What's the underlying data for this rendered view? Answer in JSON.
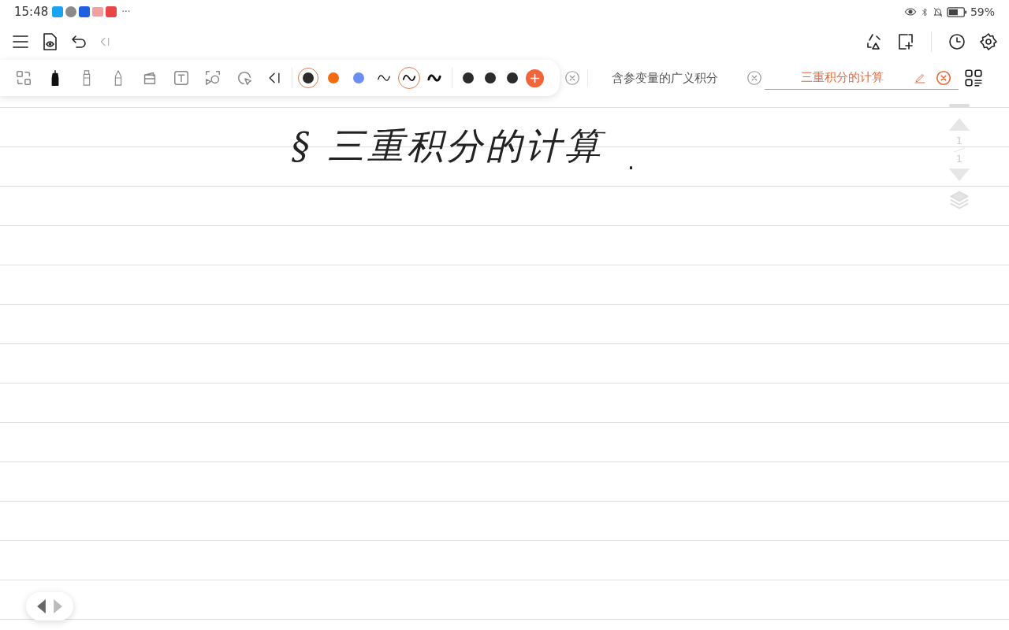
{
  "status_bar": {
    "time": "15:48",
    "more": "···",
    "battery": "59%"
  },
  "tools": [
    {
      "kind": "layout",
      "selected": false
    },
    {
      "kind": "pen",
      "selected": true
    },
    {
      "kind": "marker",
      "selected": false
    },
    {
      "kind": "pencil",
      "selected": false
    },
    {
      "kind": "eraser",
      "selected": false
    },
    {
      "kind": "text",
      "selected": false
    },
    {
      "kind": "shape",
      "selected": false
    },
    {
      "kind": "select",
      "selected": false
    }
  ],
  "colors": [
    {
      "color": "#2b2b2b",
      "selected": true
    },
    {
      "color": "#f26b0f",
      "selected": false
    },
    {
      "color": "#6a8ff0",
      "selected": false
    }
  ],
  "strokes": [
    {
      "kind": "thin",
      "selected": false
    },
    {
      "kind": "medium",
      "selected": true
    },
    {
      "kind": "thick",
      "selected": false
    }
  ],
  "presets": [
    {
      "color": "#2b2b2b"
    },
    {
      "color": "#2b2b2b"
    },
    {
      "color": "#2b2b2b"
    }
  ],
  "tabs": [
    {
      "label": "含参变量的广义积分",
      "selected": false
    },
    {
      "label": "三重积分的计算",
      "selected": true
    }
  ],
  "ink_title": "§ 三重积分的计算",
  "ink_dot": ".",
  "page_indicator": {
    "current": "1",
    "total": "1"
  }
}
